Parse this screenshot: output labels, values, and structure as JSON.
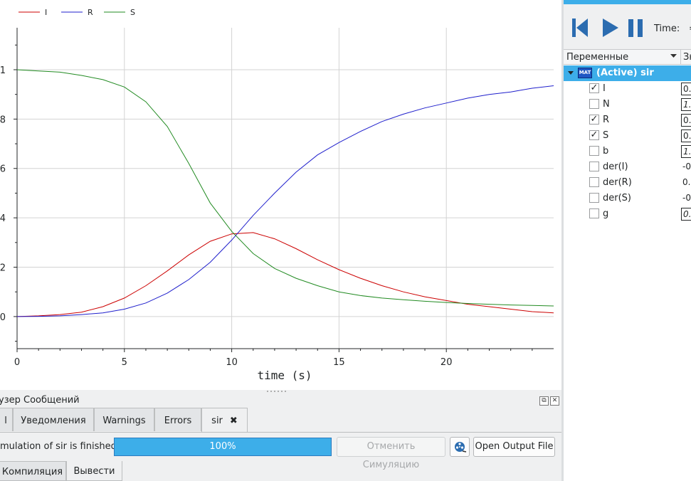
{
  "plot": {
    "legend": [
      "I",
      "R",
      "S"
    ],
    "xlabel": "time (s)",
    "x_ticks": [
      "0",
      "5",
      "10",
      "15",
      "20"
    ],
    "y_ticks": [
      "1",
      "8",
      "6",
      "4",
      "2",
      "0"
    ],
    "colors": {
      "I": "#cc0000",
      "R": "#1f1fcc",
      "S": "#228b22",
      "grid": "#d3d3d3",
      "axis": "#232627"
    }
  },
  "chart_data": {
    "type": "line",
    "xlabel": "time (s)",
    "ylabel": "",
    "xlim": [
      0,
      25
    ],
    "ylim": [
      -0.13,
      1.17
    ],
    "x": [
      0,
      1,
      2,
      3,
      4,
      5,
      6,
      7,
      8,
      9,
      10,
      11,
      12,
      13,
      14,
      15,
      16,
      17,
      18,
      19,
      20,
      21,
      22,
      23,
      24,
      25
    ],
    "series": [
      {
        "name": "I",
        "color": "#cc0000",
        "values": [
          0.0,
          0.003,
          0.008,
          0.018,
          0.04,
          0.075,
          0.125,
          0.185,
          0.25,
          0.305,
          0.335,
          0.34,
          0.315,
          0.275,
          0.23,
          0.19,
          0.155,
          0.125,
          0.1,
          0.08,
          0.065,
          0.05,
          0.04,
          0.03,
          0.02,
          0.015
        ]
      },
      {
        "name": "R",
        "color": "#1f1fcc",
        "values": [
          0.0,
          0.001,
          0.003,
          0.008,
          0.015,
          0.03,
          0.055,
          0.095,
          0.15,
          0.22,
          0.31,
          0.41,
          0.5,
          0.585,
          0.655,
          0.705,
          0.75,
          0.79,
          0.82,
          0.845,
          0.865,
          0.885,
          0.9,
          0.91,
          0.925,
          0.935
        ]
      },
      {
        "name": "S",
        "color": "#228b22",
        "values": [
          1.0,
          0.995,
          0.99,
          0.977,
          0.96,
          0.93,
          0.87,
          0.77,
          0.62,
          0.46,
          0.345,
          0.255,
          0.195,
          0.155,
          0.125,
          0.1,
          0.085,
          0.075,
          0.068,
          0.062,
          0.057,
          0.053,
          0.05,
          0.047,
          0.045,
          0.043
        ]
      }
    ]
  },
  "messages": {
    "title": "узер Сообщений",
    "tabs": [
      "l",
      "Уведомления",
      "Warnings",
      "Errors",
      "sir"
    ],
    "tab_close": "✖",
    "status": "mulation of sir is finished.",
    "progress": 100,
    "progress_label": "100%",
    "cancel_button": "Отменить Симуляцию",
    "open_output_button": "Open Output File",
    "bottom_tabs": [
      "Компиляция",
      "Вывести"
    ]
  },
  "right_panel": {
    "time_label": "Time:",
    "time_value": "=",
    "variables_header": "Переменные",
    "value_header": "Зн",
    "root_icon": "MAT",
    "root_label": "(Active) sir",
    "variables": [
      {
        "name": "I",
        "checked": true,
        "value": "0.",
        "boxed": true,
        "italic": false
      },
      {
        "name": "N",
        "checked": false,
        "value": "1.",
        "boxed": true,
        "italic": true
      },
      {
        "name": "R",
        "checked": true,
        "value": "0.",
        "boxed": true,
        "italic": false
      },
      {
        "name": "S",
        "checked": true,
        "value": "0.",
        "boxed": true,
        "italic": false
      },
      {
        "name": "b",
        "checked": false,
        "value": "1.",
        "boxed": true,
        "italic": true
      },
      {
        "name": "der(I)",
        "checked": false,
        "value": "-0",
        "boxed": false,
        "italic": false
      },
      {
        "name": "der(R)",
        "checked": false,
        "value": "0.",
        "boxed": false,
        "italic": false
      },
      {
        "name": "der(S)",
        "checked": false,
        "value": "-0",
        "boxed": false,
        "italic": false
      },
      {
        "name": "g",
        "checked": false,
        "value": "0.",
        "boxed": true,
        "italic": true
      }
    ]
  }
}
